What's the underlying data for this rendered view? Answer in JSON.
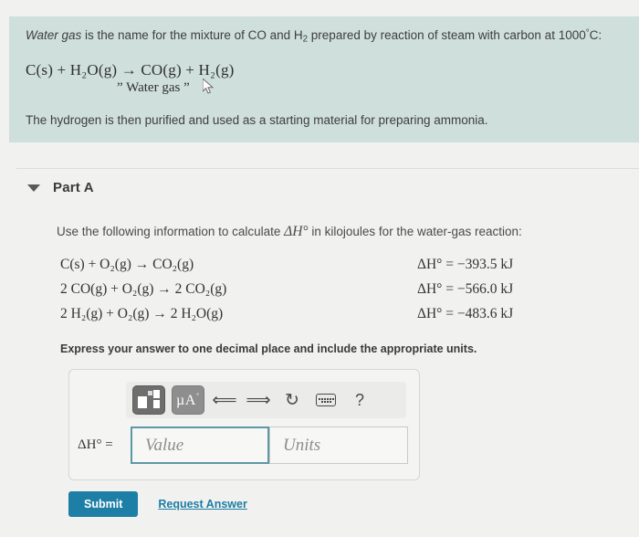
{
  "banner": {
    "intro_part1": "Water gas",
    "intro_part2": " is the name for the mixture of CO and H",
    "intro_sub": "2",
    "intro_part3": " prepared by reaction of steam with carbon at 1000",
    "intro_degree": "°",
    "intro_part4": "C:",
    "equation": "C(s) + H₂O(g) → CO(g) + H₂(g)",
    "equation_label": "” Water gas ”",
    "after_text": "The hydrogen is then purified and used as a starting material for preparing ammonia."
  },
  "part": {
    "title": "Part A",
    "caret_icon": "caret-down-icon"
  },
  "question": {
    "prompt_before": "Use the following information to calculate ",
    "prompt_symbol": "ΔH°",
    "prompt_after": " in kilojoules for the water-gas reaction:",
    "reactions": [
      "C(s) + O₂(g) → CO₂(g)",
      "2 CO(g) + O₂(g) → 2 CO₂(g)",
      "2 H₂(g) + O₂(g) → 2 H₂O(g)"
    ],
    "enthalpies": [
      "ΔH° = −393.5 kJ",
      "ΔH° = −566.0 kJ",
      "ΔH° = −483.6 kJ"
    ],
    "express_note": "Express your answer to one decimal place and include the appropriate units."
  },
  "answer": {
    "label": "ΔH° =",
    "value_placeholder": "Value",
    "value_current": "",
    "units_placeholder": "Units",
    "units_current": "",
    "toolbar": {
      "template_icon": "math-template-icon",
      "units_icon": "micro-angstrom-units-icon",
      "units_label": "μA",
      "undo_icon": "undo-arrow-icon",
      "redo_icon": "redo-arrow-icon",
      "reset_icon": "reset-circular-arrow-icon",
      "keyboard_icon": "keyboard-icon",
      "help_label": "?"
    }
  },
  "actions": {
    "submit_label": "Submit",
    "request_answer_label": "Request Answer"
  },
  "colors": {
    "banner_bg": "#cfdfdb",
    "page_bg": "#f1f1ef",
    "accent_blue": "#1d7ea6",
    "focus_border": "#5e97a5"
  }
}
